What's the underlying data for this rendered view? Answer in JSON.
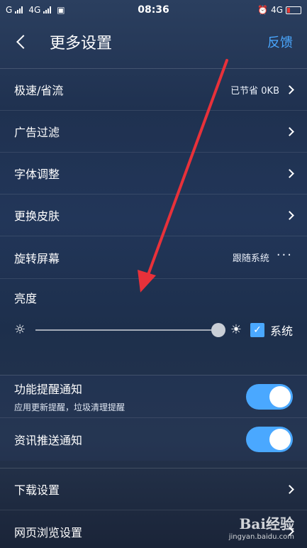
{
  "status_bar": {
    "left_signal_1": "G",
    "left_signal_2": "4G",
    "time": "08:36",
    "right_network": "4G"
  },
  "header": {
    "title": "更多设置",
    "feedback": "反馈"
  },
  "settings": [
    {
      "label": "极速/省流",
      "value": "已节省 0KB"
    },
    {
      "label": "广告过滤",
      "value": ""
    },
    {
      "label": "字体调整",
      "value": ""
    },
    {
      "label": "更换皮肤",
      "value": ""
    },
    {
      "label": "旋转屏幕",
      "value": "跟随系统"
    }
  ],
  "brightness": {
    "label": "亮度",
    "level": 0.99,
    "system_checked": true,
    "system_label": "系统"
  },
  "notifications": [
    {
      "label": "功能提醒通知",
      "sub": "应用更新提醒，垃圾清理提醒",
      "on": true
    },
    {
      "label": "资讯推送通知",
      "sub": "",
      "on": true
    }
  ],
  "more_settings": [
    {
      "label": "下载设置"
    },
    {
      "label": "网页浏览设置"
    }
  ],
  "watermark": {
    "logo": "Bai经验",
    "url": "jingyan.baidu.com"
  },
  "colors": {
    "accent": "#4aa8ff",
    "annotation_arrow": "#e8313a"
  }
}
